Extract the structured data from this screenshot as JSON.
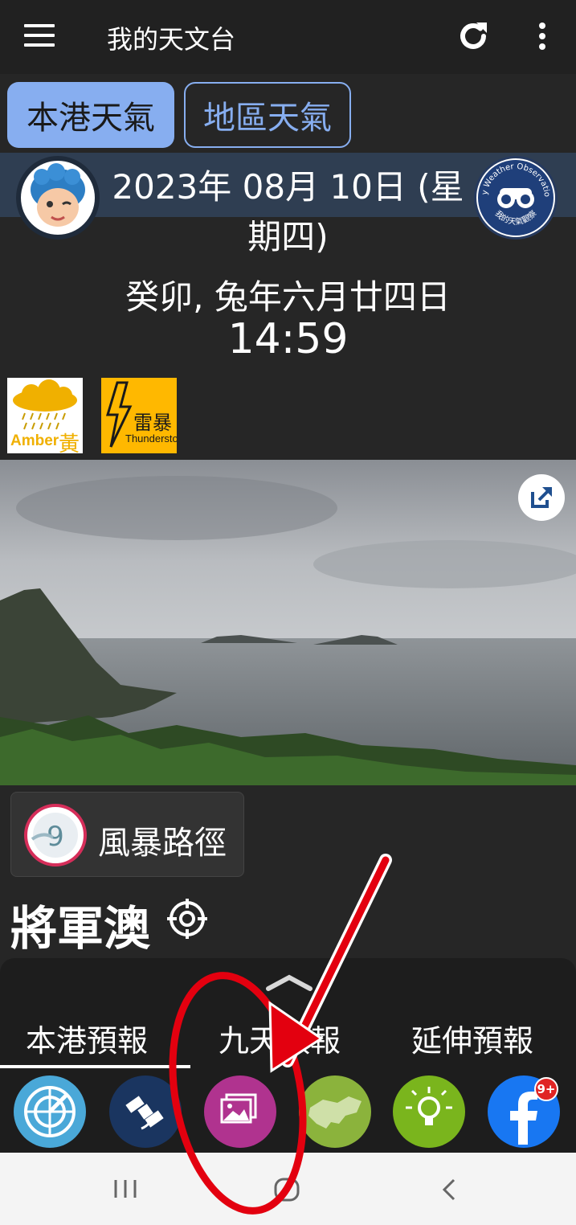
{
  "header": {
    "title": "我的天文台",
    "menu_icon": "menu-icon",
    "refresh_icon": "refresh-icon",
    "more_icon": "more-vert-icon"
  },
  "tabs": [
    {
      "label": "本港天氣",
      "selected": true
    },
    {
      "label": "地區天氣",
      "selected": false
    }
  ],
  "date": {
    "gregorian": "2023年 08月 10日 (星期四)",
    "lunar": "癸卯, 兔年六月廿四日",
    "time": "14:59"
  },
  "obs_logo": {
    "arc_text": "My Weather Observation",
    "cn_text": "我的天氣觀察"
  },
  "warnings": [
    {
      "name": "amber-rainstorm-warning-icon",
      "text_en": "Amber",
      "text_cn": "黃"
    },
    {
      "name": "thunderstorm-warning-icon",
      "text_cn": "雷暴",
      "text_en": "Thunderstorm"
    }
  ],
  "storm_track": {
    "label": "風暴路徑",
    "icon_text": "9"
  },
  "location": {
    "name": "將軍澳"
  },
  "forecast_tabs": [
    "本港預報",
    "九天預報",
    "延伸預報"
  ],
  "shortcuts": [
    {
      "name": "radar-icon",
      "color": "#4aa8d8"
    },
    {
      "name": "satellite-icon",
      "color": "#1a3560"
    },
    {
      "name": "photos-icon",
      "color": "#b0338f"
    },
    {
      "name": "hk-map-icon",
      "color": "#8bb33c"
    },
    {
      "name": "tips-lightbulb-icon",
      "color": "#7ab51d"
    },
    {
      "name": "facebook-icon",
      "color": "#1877f2",
      "badge": "9+"
    }
  ],
  "colors": {
    "accent": "#87aef0",
    "annotation": "#e3000f"
  }
}
